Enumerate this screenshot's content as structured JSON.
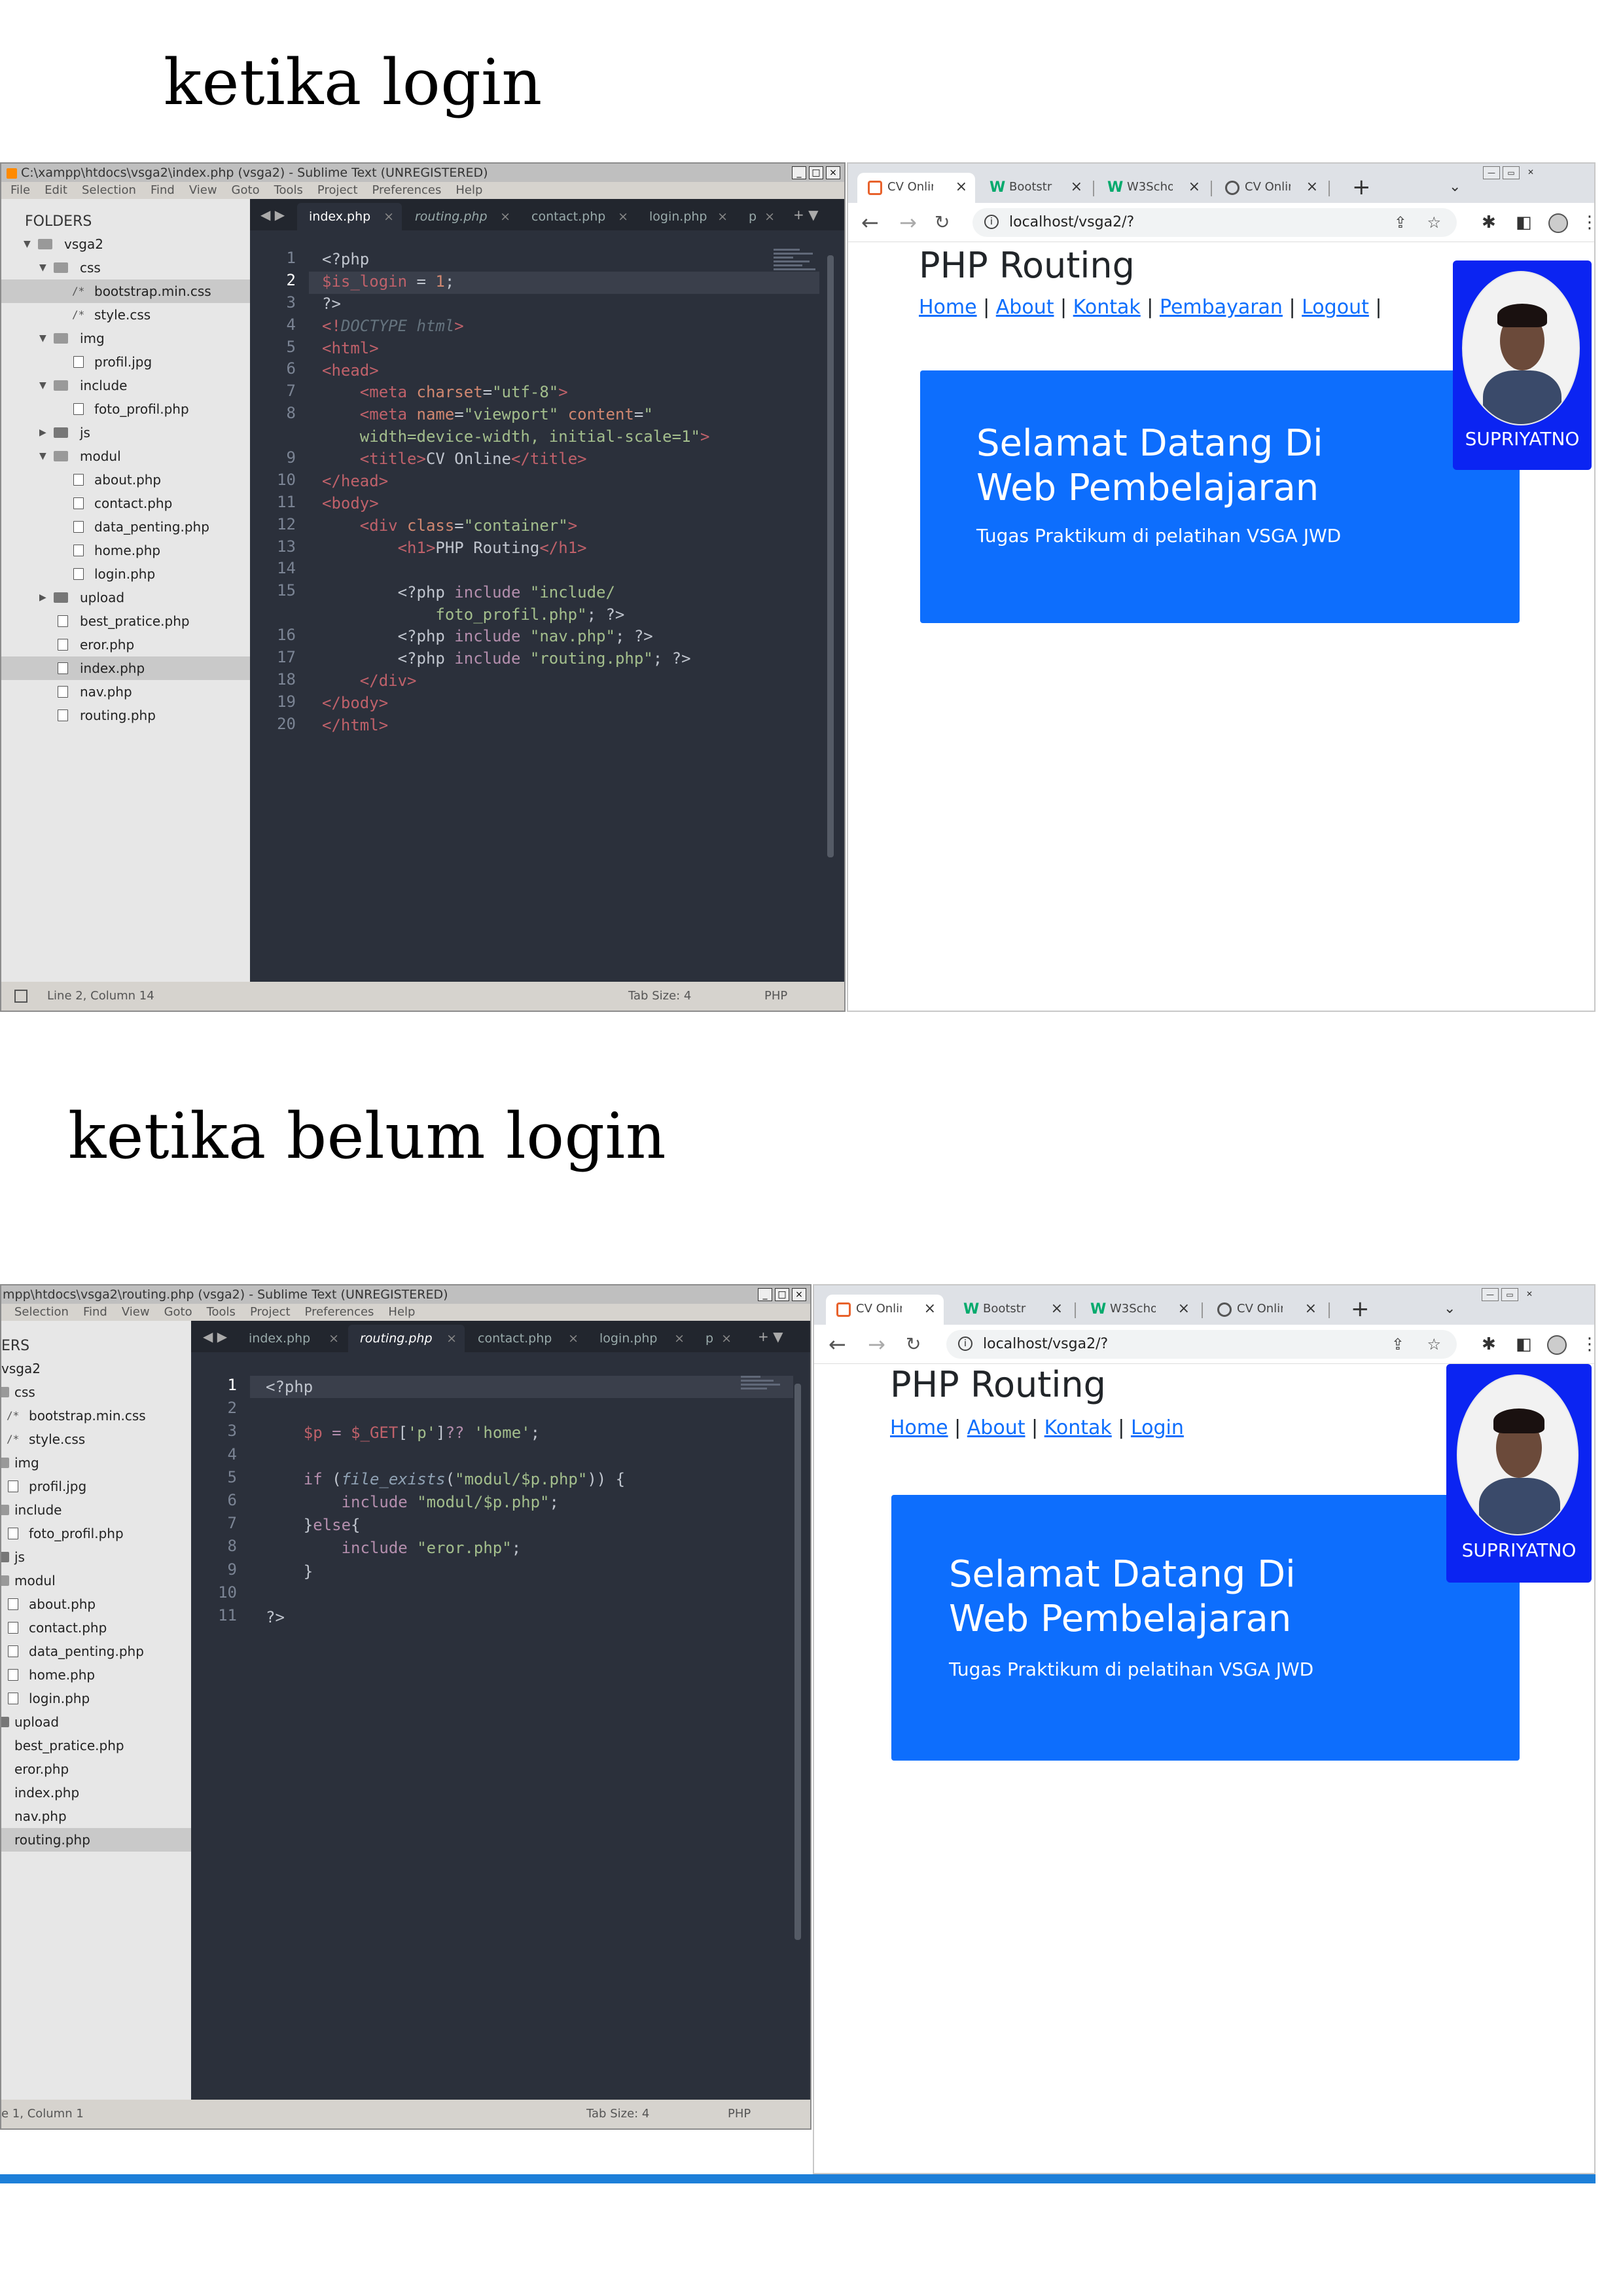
{
  "headings": {
    "top": "ketika login",
    "bottom": "ketika belum login"
  },
  "editor1": {
    "title": "C:\\xampp\\htdocs\\vsga2\\index.php (vsga2) - Sublime Text (UNREGISTERED)",
    "menu": [
      "File",
      "Edit",
      "Selection",
      "Find",
      "View",
      "Goto",
      "Tools",
      "Project",
      "Preferences",
      "Help"
    ],
    "folders_title": "FOLDERS",
    "tree": [
      "vsga2",
      "css",
      "bootstrap.min.css",
      "style.css",
      "img",
      "profil.jpg",
      "include",
      "foto_profil.php",
      "js",
      "modul",
      "about.php",
      "contact.php",
      "data_penting.php",
      "home.php",
      "login.php",
      "upload",
      "best_pratice.php",
      "eror.php",
      "index.php",
      "nav.php",
      "routing.php"
    ],
    "tabs": [
      "index.php",
      "routing.php",
      "contact.php",
      "login.php",
      "p"
    ],
    "line_numbers": [
      "1",
      "2",
      "3",
      "4",
      "5",
      "6",
      "7",
      "8",
      "",
      "9",
      "10",
      "11",
      "12",
      "13",
      "14",
      "15",
      "",
      "16",
      "17",
      "18",
      "19",
      "20"
    ],
    "status": {
      "position": "Line 2, Column 14",
      "tab_size": "Tab Size: 4",
      "syntax": "PHP"
    }
  },
  "editor2": {
    "title": "mpp\\htdocs\\vsga2\\routing.php (vsga2) - Sublime Text (UNREGISTERED)",
    "menu": [
      "Selection",
      "Find",
      "View",
      "Goto",
      "Tools",
      "Project",
      "Preferences",
      "Help"
    ],
    "folders_title": "ERS",
    "tree": [
      "vsga2",
      "css",
      "bootstrap.min.css",
      "style.css",
      "img",
      "profil.jpg",
      "include",
      "foto_profil.php",
      "js",
      "modul",
      "about.php",
      "contact.php",
      "data_penting.php",
      "home.php",
      "login.php",
      "upload",
      "best_pratice.php",
      "eror.php",
      "index.php",
      "nav.php",
      "routing.php"
    ],
    "tabs": [
      "index.php",
      "routing.php",
      "contact.php",
      "login.php",
      "p"
    ],
    "line_numbers": [
      "1",
      "2",
      "3",
      "4",
      "5",
      "6",
      "7",
      "8",
      "9",
      "10",
      "11"
    ],
    "status": {
      "position": "e 1, Column 1",
      "tab_size": "Tab Size: 4",
      "syntax": "PHP"
    }
  },
  "browser1": {
    "tabs": [
      "CV Onlin",
      "Bootstr",
      "W3Scho",
      "CV Onlin"
    ],
    "url": "localhost/vsga2/?",
    "page_title": "PHP Routing",
    "nav": [
      "Home",
      "About",
      "Kontak",
      "Pembayaran",
      "Logout"
    ],
    "jumbo_heading": "Selamat Datang Di Web Pembelajaran",
    "jumbo_sub": "Tugas Praktikum di pelatihan VSGA JWD",
    "profile_name": "SUPRIYATNO"
  },
  "browser2": {
    "tabs": [
      "CV Onlin",
      "Bootstr",
      "W3Scho",
      "CV Onlin"
    ],
    "url": "localhost/vsga2/?",
    "page_title": "PHP Routing",
    "nav": [
      "Home",
      "About",
      "Kontak",
      "Login"
    ],
    "jumbo_heading": "Selamat Datang Di Web Pembelajaran",
    "jumbo_sub": "Tugas Praktikum di pelatihan VSGA JWD",
    "profile_name": "SUPRIYATNO"
  },
  "colors": {
    "primary": "#0d6efd",
    "profile_bg": "#0b24f2",
    "editor_bg": "#2b303b",
    "taskbar": "#1d7fd8"
  }
}
